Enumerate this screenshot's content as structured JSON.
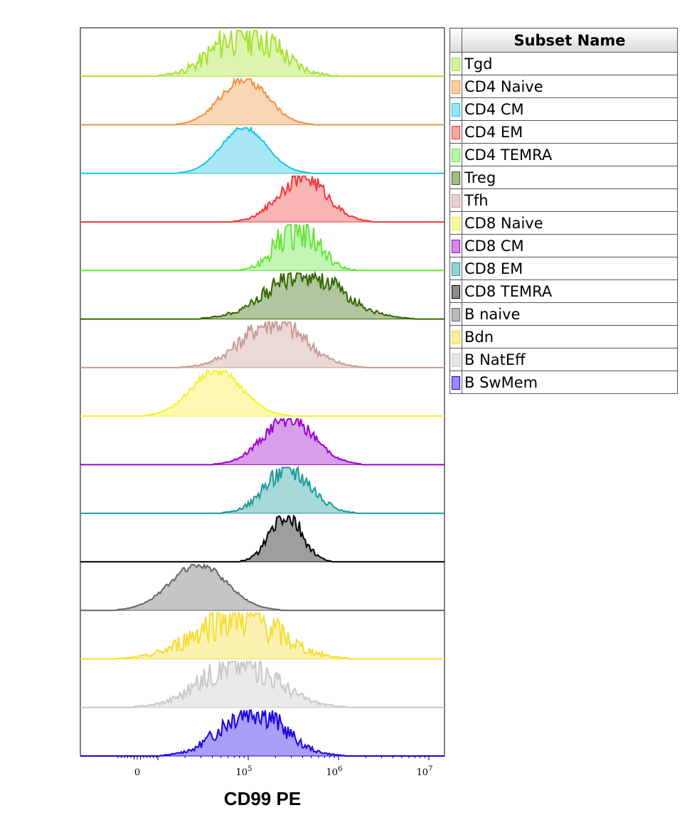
{
  "chart_data": {
    "type": "area",
    "xlabel": "CD99 PE",
    "x_scale": "biexponential",
    "x_ticks": [
      {
        "value": 0,
        "label": "0"
      },
      {
        "value": 100000,
        "label": "10^5"
      },
      {
        "value": 1000000,
        "label": "10^6"
      },
      {
        "value": 10000000,
        "label": "10^7"
      }
    ],
    "legend_header": "Subset Name",
    "series": [
      {
        "name": "Tgd",
        "color": "#a6e22e",
        "peak": 95000,
        "spread": 0.55,
        "noise": 0.55
      },
      {
        "name": "CD4 Naive",
        "color": "#f0923c",
        "peak": 90000,
        "spread": 0.42,
        "noise": 0.12
      },
      {
        "name": "CD4 CM",
        "color": "#19c3e6",
        "peak": 90000,
        "spread": 0.4,
        "noise": 0.05
      },
      {
        "name": "CD4 EM",
        "color": "#ee3a3a",
        "peak": 400000,
        "spread": 0.42,
        "noise": 0.22
      },
      {
        "name": "CD4 TEMRA",
        "color": "#66e63a",
        "peak": 350000,
        "spread": 0.35,
        "noise": 0.55
      },
      {
        "name": "Treg",
        "color": "#336600",
        "peak": 420000,
        "spread": 0.65,
        "noise": 0.28
      },
      {
        "name": "Tfh",
        "color": "#c89a96",
        "peak": 190000,
        "spread": 0.55,
        "noise": 0.3
      },
      {
        "name": "CD8 Naive",
        "color": "#f5f032",
        "peak": 45000,
        "spread": 0.45,
        "noise": 0.1
      },
      {
        "name": "CD8 CM",
        "color": "#9900cc",
        "peak": 280000,
        "spread": 0.45,
        "noise": 0.18
      },
      {
        "name": "CD8 EM",
        "color": "#1a9a9a",
        "peak": 280000,
        "spread": 0.4,
        "noise": 0.28
      },
      {
        "name": "CD8 TEMRA",
        "color": "#000000",
        "peak": 260000,
        "spread": 0.28,
        "noise": 0.28
      },
      {
        "name": "B naive",
        "color": "#666666",
        "peak": 28000,
        "spread": 0.5,
        "noise": 0.08
      },
      {
        "name": "Bdn",
        "color": "#f5dd32",
        "peak": 75000,
        "spread": 0.7,
        "noise": 0.55
      },
      {
        "name": "B NatEff",
        "color": "#c8c8c8",
        "peak": 80000,
        "spread": 0.65,
        "noise": 0.4
      },
      {
        "name": "B SwMem",
        "color": "#1a00e6",
        "peak": 110000,
        "spread": 0.55,
        "noise": 0.35
      }
    ]
  }
}
